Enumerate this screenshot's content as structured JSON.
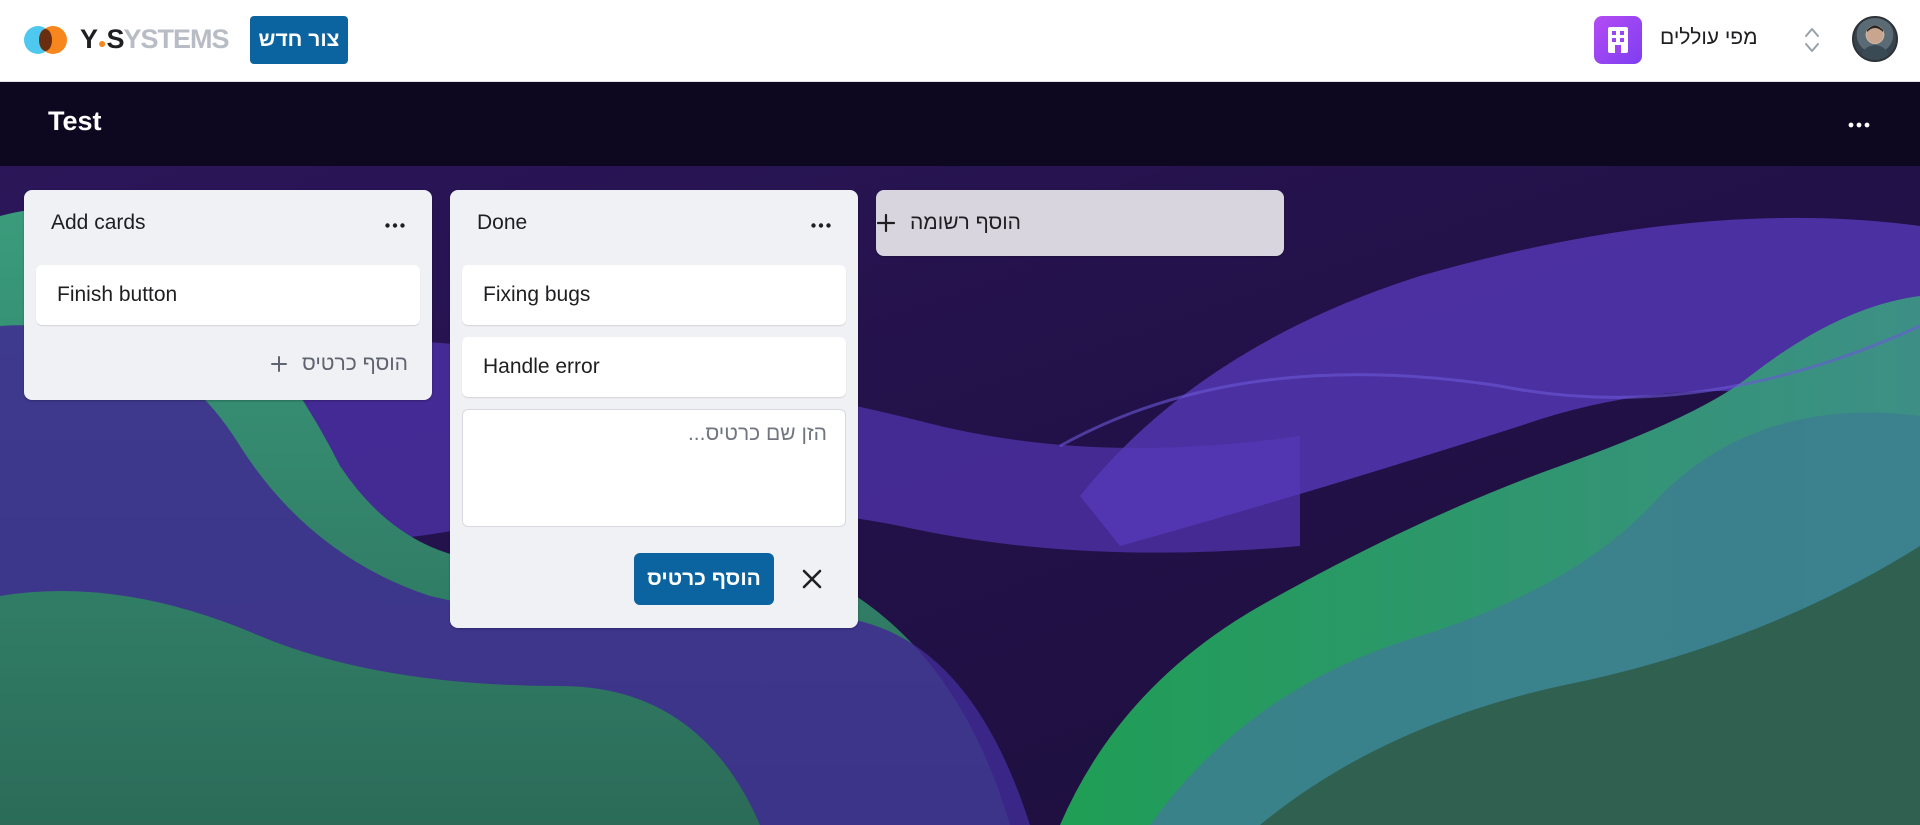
{
  "brand": {
    "name_dark": "Y",
    "name_dot": "●",
    "name_s": "S",
    "name_light": "YSTEMS"
  },
  "topbar": {
    "create_label": "צור חדש"
  },
  "workspace": {
    "name": "מפי עוללים",
    "icon": "building-icon"
  },
  "user": {
    "avatar": "user-avatar"
  },
  "board": {
    "title": "Test"
  },
  "lists": [
    {
      "title": "Add cards",
      "cards": [
        "Finish button"
      ],
      "add_card_label": "הוסף כרטיס"
    },
    {
      "title": "Done",
      "cards": [
        "Fixing bugs",
        "Handle error"
      ],
      "composer": {
        "placeholder": "הזן שם כרטיס...",
        "value": "",
        "submit_label": "הוסף כרטיס"
      }
    }
  ],
  "add_list": {
    "label": "הוסף רשומה"
  },
  "colors": {
    "primary": "#0b64a0",
    "list_bg": "#f0f1f4",
    "header_bg": "#0e0720",
    "workspace_icon": "#9b45f2"
  }
}
